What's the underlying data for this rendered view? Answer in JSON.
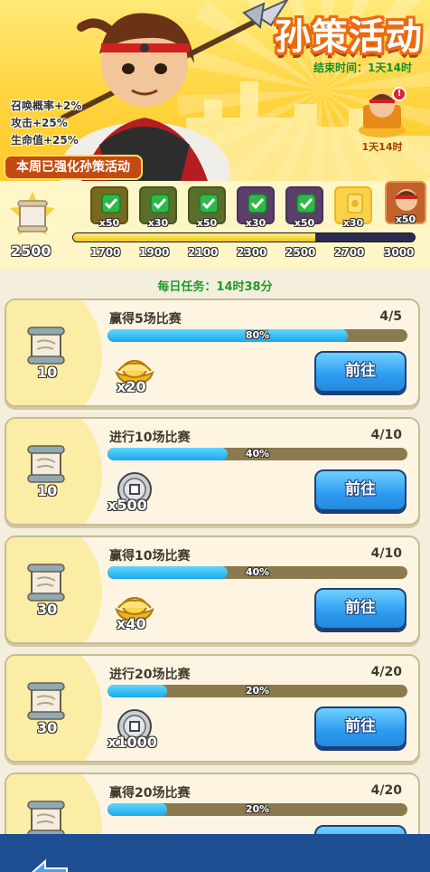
{
  "header": {
    "title": "孙策活动",
    "end_time_label": "结束时间：1天14时",
    "stats": [
      "召唤概率+2%",
      "攻击+25%",
      "生命值+25%"
    ],
    "strengthen_label": "本周已强化孙策活动",
    "hero_box_label": "1天14时",
    "hero_box_alert": "!"
  },
  "progress": {
    "score": "2500",
    "fill_percent": 71,
    "ticks": [
      "1700",
      "1900",
      "2100",
      "2300",
      "2500",
      "2700",
      "3000"
    ],
    "rewards": [
      {
        "count": "x50",
        "style": "green",
        "claimed": true
      },
      {
        "count": "x30",
        "style": "blue",
        "claimed": true
      },
      {
        "count": "x50",
        "style": "blue",
        "claimed": true
      },
      {
        "count": "x30",
        "style": "purple",
        "claimed": true
      },
      {
        "count": "x50",
        "style": "purple",
        "claimed": true
      },
      {
        "count": "x30",
        "style": "gold",
        "claimed": false
      },
      {
        "count": "x50",
        "style": "hero",
        "claimed": false
      }
    ]
  },
  "daily": {
    "label": "每日任务：14时38分"
  },
  "tasks": [
    {
      "name": "赢得5场比赛",
      "progress": "4/5",
      "percent_label": "80%",
      "percent": 80,
      "scroll": "10",
      "reward_icon": "gold-ingot-icon",
      "reward_count": "x20",
      "button": "前往"
    },
    {
      "name": "进行10场比赛",
      "progress": "4/10",
      "percent_label": "40%",
      "percent": 40,
      "scroll": "10",
      "reward_icon": "silver-coin-icon",
      "reward_count": "x500",
      "button": "前往"
    },
    {
      "name": "赢得10场比赛",
      "progress": "4/10",
      "percent_label": "40%",
      "percent": 40,
      "scroll": "30",
      "reward_icon": "gold-ingot-icon",
      "reward_count": "x40",
      "button": "前往"
    },
    {
      "name": "进行20场比赛",
      "progress": "4/20",
      "percent_label": "20%",
      "percent": 20,
      "scroll": "30",
      "reward_icon": "silver-coin-icon",
      "reward_count": "x1000",
      "button": "前往"
    },
    {
      "name": "赢得20场比赛",
      "progress": "4/20",
      "percent_label": "20%",
      "percent": 20,
      "scroll": "",
      "reward_icon": "gold-ingot-icon",
      "reward_count": "",
      "button": ""
    }
  ],
  "colors": {
    "accent_orange": "#ec6a12",
    "green_text": "#1f9b2b",
    "button_blue": "#2c9bf0",
    "bottom_bar": "#1f4f93"
  }
}
